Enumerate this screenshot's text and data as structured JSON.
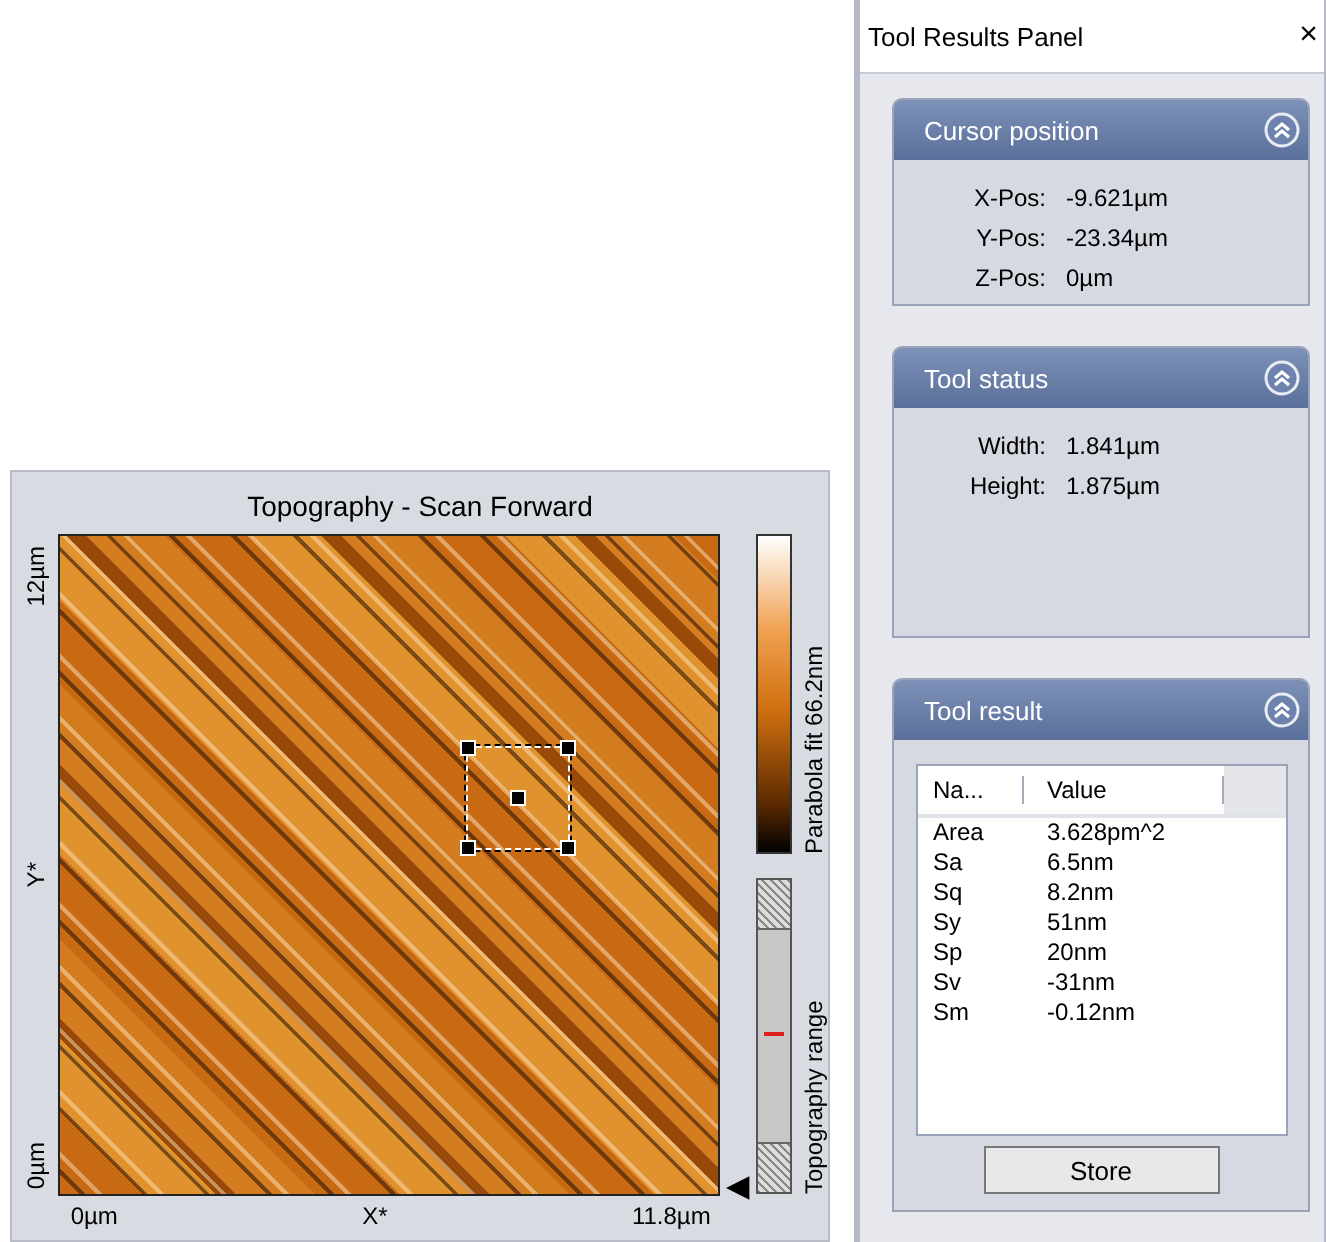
{
  "image_view": {
    "title": "Topography - Scan Forward",
    "y_axis": {
      "top": "12µm",
      "label": "Y*",
      "bottom": "0µm"
    },
    "x_axis": {
      "left": "0µm",
      "label": "X*",
      "right": "11.8µm"
    },
    "color_bar": {
      "label": "Parabola fit 66.2nm"
    },
    "range_bar": {
      "label": "Topography range"
    }
  },
  "panel": {
    "title": "Tool Results Panel",
    "close": "×",
    "sections": [
      {
        "title": "Cursor position",
        "fields": [
          {
            "label": "X-Pos:",
            "value": "-9.621µm"
          },
          {
            "label": "Y-Pos:",
            "value": "-23.34µm"
          },
          {
            "label": "Z-Pos:",
            "value": "0µm"
          }
        ]
      },
      {
        "title": "Tool status",
        "fields": [
          {
            "label": "Width:",
            "value": "1.841µm"
          },
          {
            "label": "Height:",
            "value": "1.875µm"
          }
        ]
      }
    ],
    "result": {
      "title": "Tool result",
      "columns": [
        "Na...",
        "Value"
      ],
      "rows": [
        [
          "Area",
          "3.628pm^2"
        ],
        [
          "Sa",
          "6.5nm"
        ],
        [
          "Sq",
          "8.2nm"
        ],
        [
          "Sy",
          "51nm"
        ],
        [
          "Sp",
          "20nm"
        ],
        [
          "Sv",
          "-31nm"
        ],
        [
          "Sm",
          "-0.12nm"
        ]
      ],
      "button": "Store"
    }
  }
}
